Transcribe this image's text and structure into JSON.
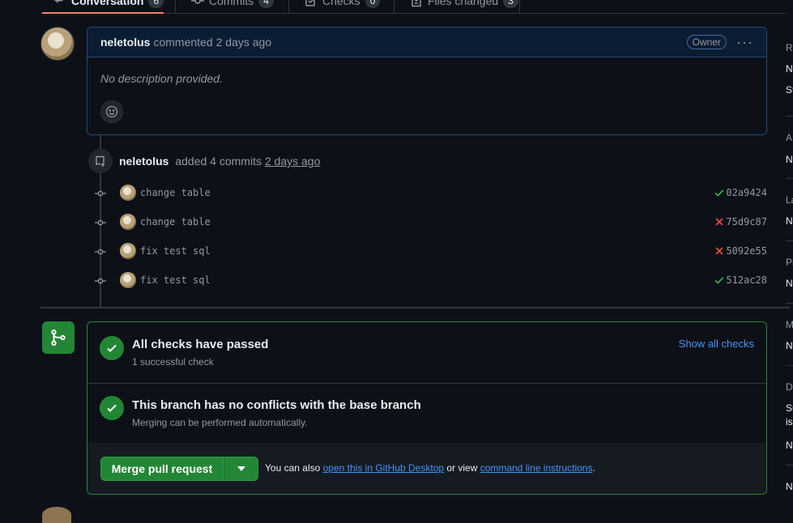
{
  "tabs": [
    {
      "label": "Conversation",
      "count": "6",
      "icon": "comment-discussion-icon"
    },
    {
      "label": "Commits",
      "count": "4",
      "icon": "git-commit-icon"
    },
    {
      "label": "Checks",
      "count": "0",
      "icon": "checklist-icon"
    },
    {
      "label": "Files changed",
      "count": "3",
      "icon": "file-diff-icon"
    }
  ],
  "comment": {
    "author": "neletolus",
    "action": "commented",
    "time": "2 days ago",
    "badge": "Owner",
    "body": "No description provided.",
    "menu_icon": "kebab-horizontal-icon",
    "reaction_icon": "smiley-icon"
  },
  "push_event": {
    "author": "neletolus",
    "action": "added 4 commits",
    "time": "2 days ago",
    "icon": "repo-push-icon"
  },
  "commits": [
    {
      "message": "change table",
      "sha": "02a9424",
      "status": "success"
    },
    {
      "message": "change table",
      "sha": "75d9c87",
      "status": "failure"
    },
    {
      "message": "fix test sql",
      "sha": "5092e55",
      "status": "failure"
    },
    {
      "message": "fix test sql",
      "sha": "512ac28",
      "status": "success"
    }
  ],
  "merge_box": {
    "checks_title": "All checks have passed",
    "checks_sub": "1 successful check",
    "show_all": "Show all checks",
    "conflicts_title": "This branch has no conflicts with the base branch",
    "conflicts_sub": "Merging can be performed automatically.",
    "merge_button": "Merge pull request",
    "footer_prefix": "You can also",
    "footer_link1": "open this in GitHub Desktop",
    "footer_mid": "or view",
    "footer_link2": "command line instructions",
    "footer_suffix": ".",
    "icon": "git-merge-icon"
  },
  "sidebar_fragments": [
    "R",
    "N",
    "St",
    "A",
    "N",
    "La",
    "N",
    "Pr",
    "N",
    "M",
    "N",
    "D",
    "Su",
    "is",
    "N",
    "N"
  ],
  "colors": {
    "background": "#0d1117",
    "accent_green": "#238636",
    "link_blue": "#4493f8",
    "danger_red": "#f85149",
    "success_green": "#3fb950"
  }
}
